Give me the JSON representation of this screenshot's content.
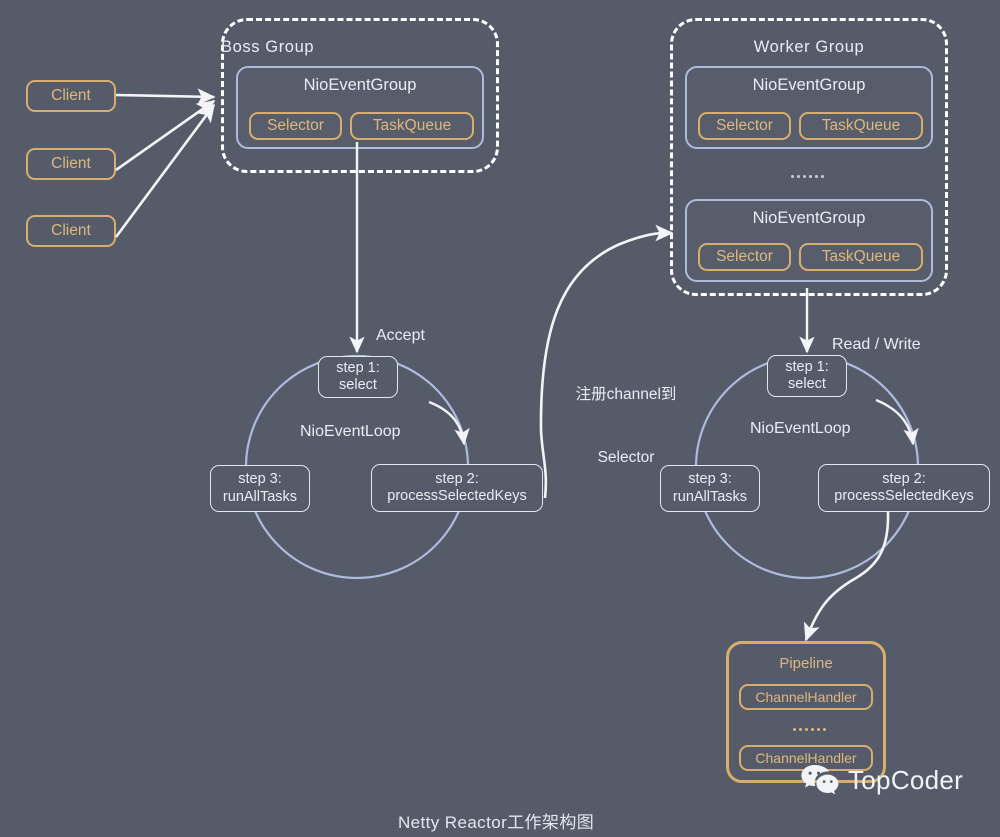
{
  "diagram": {
    "caption": "Netty Reactor工作架构图",
    "background_color": "#555b69",
    "accent_amber": "#d9ad6e",
    "accent_blue": "#aebbdd",
    "accent_white": "#e9ecf2"
  },
  "clients": [
    {
      "label": "Client"
    },
    {
      "label": "Client"
    },
    {
      "label": "Client"
    }
  ],
  "boss_group": {
    "title": "Boss Group",
    "event_groups": [
      {
        "title": "NioEventGroup",
        "children": [
          {
            "label": "Selector"
          },
          {
            "label": "TaskQueue"
          }
        ]
      }
    ]
  },
  "worker_group": {
    "title": "Worker Group",
    "ellipsis": "......",
    "event_groups": [
      {
        "title": "NioEventGroup",
        "children": [
          {
            "label": "Selector"
          },
          {
            "label": "TaskQueue"
          }
        ]
      },
      {
        "title": "NioEventGroup",
        "children": [
          {
            "label": "Selector"
          },
          {
            "label": "TaskQueue"
          }
        ]
      }
    ]
  },
  "boss_loop": {
    "name": "NioEventLoop",
    "incoming_label": "Accept",
    "steps": [
      {
        "line1": "step 1:",
        "line2": "select"
      },
      {
        "line1": "step 2:",
        "line2": "processSelectedKeys"
      },
      {
        "line1": "step 3:",
        "line2": "runAllTasks"
      }
    ]
  },
  "worker_loop": {
    "name": "NioEventLoop",
    "incoming_label": "Read / Write",
    "steps": [
      {
        "line1": "step 1:",
        "line2": "select"
      },
      {
        "line1": "step 2:",
        "line2": "processSelectedKeys"
      },
      {
        "line1": "step 3:",
        "line2": "runAllTasks"
      }
    ]
  },
  "register_arrow": {
    "line1": "注册channel到",
    "line2": "Selector"
  },
  "pipeline": {
    "title": "Pipeline",
    "ellipsis": "......",
    "handlers": [
      {
        "label": "ChannelHandler"
      },
      {
        "label": "ChannelHandler"
      }
    ]
  },
  "brand": {
    "name": "TopCoder",
    "icon": "wechat-icon"
  }
}
